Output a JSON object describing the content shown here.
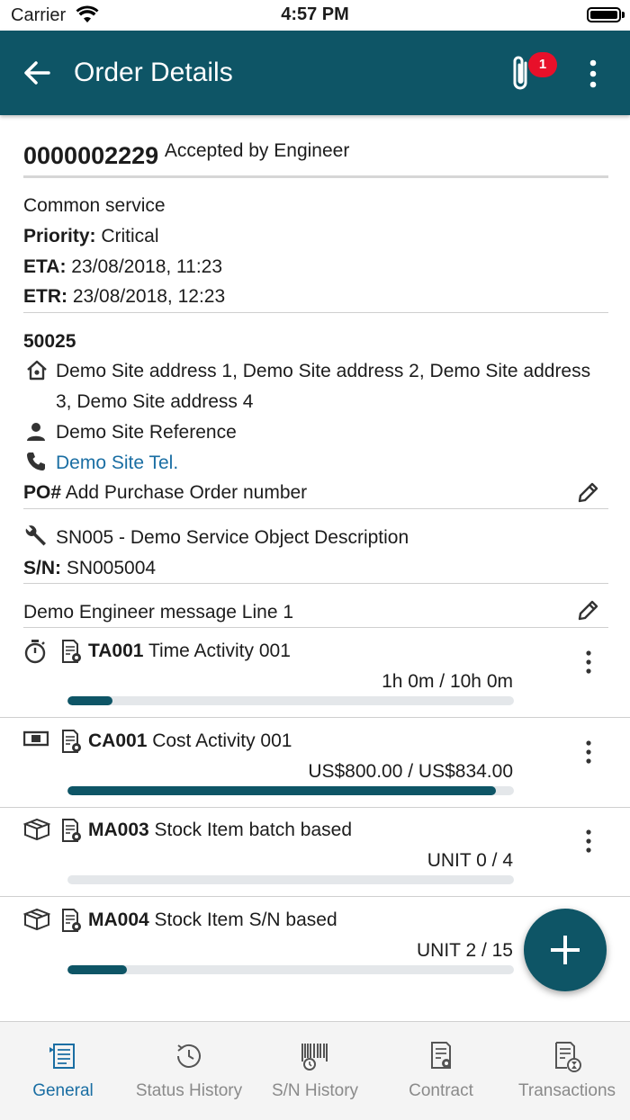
{
  "status_bar": {
    "carrier": "Carrier",
    "time": "4:57 PM"
  },
  "app_bar": {
    "title": "Order Details",
    "attachment_count": "1"
  },
  "order": {
    "number": "0000002229",
    "status": "Accepted by Engineer",
    "service_type": "Common service",
    "priority_label": "Priority:",
    "priority_value": " Critical",
    "eta_label": "ETA:",
    "eta_value": " 23/08/2018, 11:23",
    "etr_label": "ETR:",
    "etr_value": " 23/08/2018, 12:23"
  },
  "site": {
    "code": "50025",
    "address_line1": "Demo Site address 1, Demo Site address 2, Demo Site address",
    "address_line2": "3, Demo Site address 4",
    "reference": "Demo Site Reference",
    "tel": "Demo Site Tel.",
    "po_label": "PO#",
    "po_placeholder": " Add Purchase Order number"
  },
  "service_object": {
    "description": "SN005 - Demo Service Object Description",
    "sn_label": "S/N:",
    "sn_value": " SN005004"
  },
  "engineer_message": "Demo Engineer message Line 1",
  "activities": [
    {
      "icon": "stopwatch-icon",
      "code": "TA001",
      "name": " Time Activity 001",
      "amount": "1h 0m / 10h 0m",
      "progress": 0.1,
      "has_menu": true
    },
    {
      "icon": "cash-icon",
      "code": "CA001",
      "name": " Cost Activity 001",
      "amount": "US$800.00 / US$834.00",
      "progress": 0.96,
      "has_menu": true
    },
    {
      "icon": "package-icon",
      "code": "MA003",
      "name": " Stock Item batch based",
      "amount": "UNIT 0 / 4",
      "progress": 0.0,
      "has_menu": true
    },
    {
      "icon": "package-icon",
      "code": "MA004",
      "name": " Stock Item S/N based",
      "amount": "UNIT 2 / 15",
      "progress": 0.133,
      "has_menu": false
    }
  ],
  "tabs": [
    {
      "label": "General",
      "icon": "general-list-icon",
      "active": true
    },
    {
      "label": "Status History",
      "icon": "history-clock-icon",
      "active": false
    },
    {
      "label": "S/N History",
      "icon": "barcode-history-icon",
      "active": false
    },
    {
      "label": "Contract",
      "icon": "contract-certificate-icon",
      "active": false
    },
    {
      "label": "Transactions",
      "icon": "transactions-hourglass-icon",
      "active": false
    }
  ],
  "colors": {
    "primary": "#0e5566",
    "badge": "#e8102a",
    "link": "#1a6ea3",
    "inactive_tab": "#8a8a8a"
  }
}
